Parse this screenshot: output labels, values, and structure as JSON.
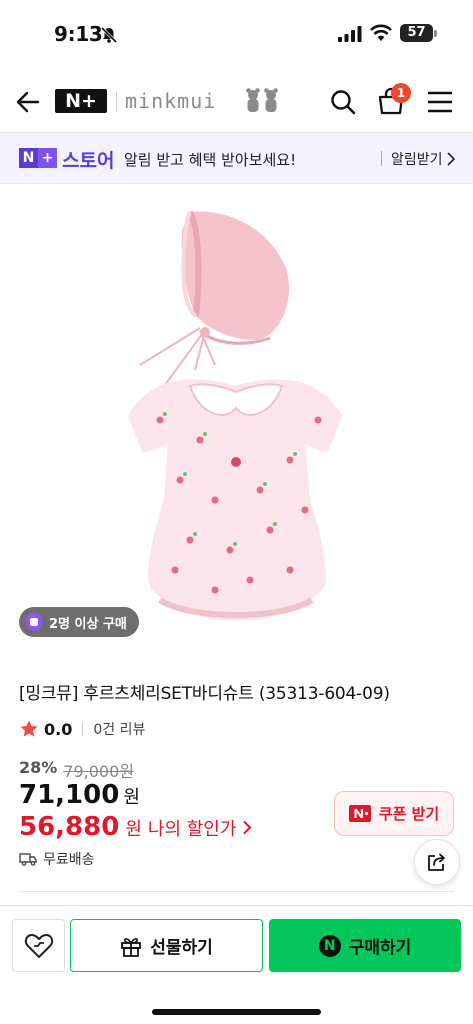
{
  "status_bar": {
    "time": "9:13",
    "battery": "57"
  },
  "header": {
    "store_logo": "N+",
    "brand_text": "minkmui",
    "cart_count": "1"
  },
  "banner": {
    "logo": "N+",
    "store_label": "스토어",
    "message": "알림 받고 혜택 받아보세요!",
    "alarm_label": "알림받기"
  },
  "product": {
    "group_badge": "2명 이상 구매",
    "title": "[밍크뮤] 후르츠체리SET바디슈트 (35313-604-09)",
    "rating": "0.0",
    "reviews": "0건 리뷰",
    "discount_pct": "28%",
    "original_price": "79,000원",
    "price": "71,100",
    "price_unit": "원",
    "my_price": "56,880",
    "my_price_unit": "원",
    "my_price_label": "나의 할인가",
    "coupon_label": "쿠폰 받기",
    "shipping": "무료배송"
  },
  "bottom_bar": {
    "gift_label": "선물하기",
    "buy_label": "구매하기",
    "buy_icon": "N"
  },
  "colors": {
    "naver_green": "#03c75a",
    "discount_red": "#e2172b",
    "store_purple": "#5b3bd8",
    "badge_red": "#f0462b"
  }
}
